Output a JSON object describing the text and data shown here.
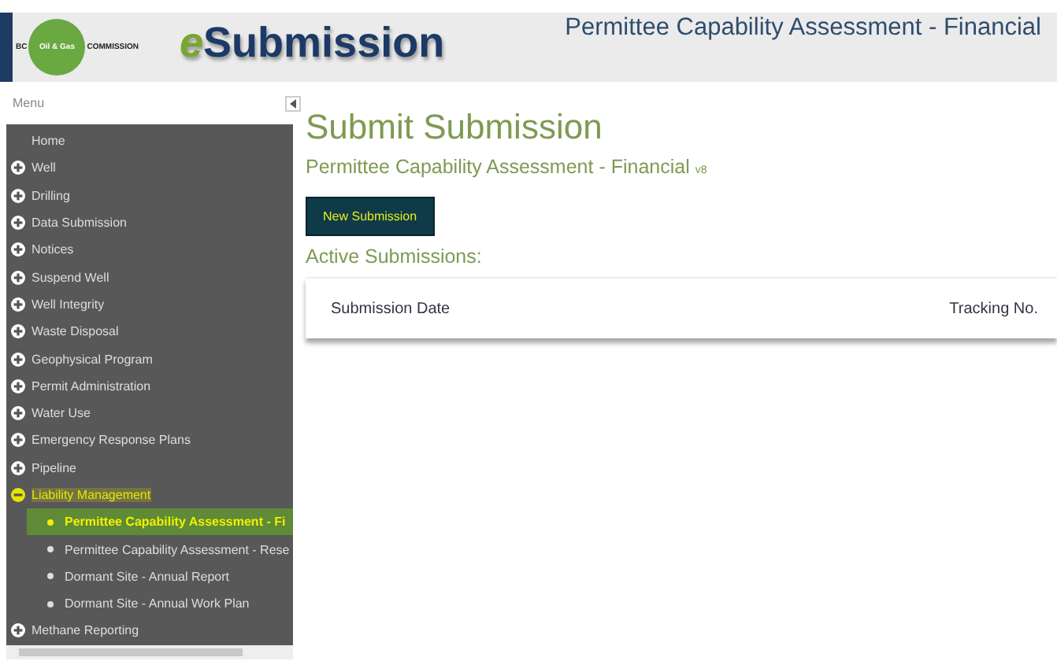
{
  "header": {
    "logo": {
      "left": "BC",
      "center": "Oil & Gas",
      "right": "COMMISSION"
    },
    "app_name": {
      "prefix": "e",
      "rest": "Submission"
    },
    "page_title": "Permittee Capability Assessment - Financial"
  },
  "sidebar": {
    "title": "Menu",
    "items": [
      {
        "label": "Home",
        "kind": "link",
        "highlighted": false
      },
      {
        "label": "Well",
        "kind": "group",
        "expanded": false,
        "highlighted": false
      },
      {
        "label": "Drilling",
        "kind": "group",
        "expanded": false,
        "highlighted": false
      },
      {
        "label": "Data Submission",
        "kind": "group",
        "expanded": false,
        "highlighted": false
      },
      {
        "label": "Notices",
        "kind": "group",
        "expanded": false,
        "highlighted": false
      },
      {
        "label": "Suspend Well",
        "kind": "group",
        "expanded": false,
        "highlighted": false
      },
      {
        "label": "Well Integrity",
        "kind": "group",
        "expanded": false,
        "highlighted": false
      },
      {
        "label": "Waste Disposal",
        "kind": "group",
        "expanded": false,
        "highlighted": false
      },
      {
        "label": "Geophysical Program",
        "kind": "group",
        "expanded": false,
        "highlighted": false
      },
      {
        "label": "Permit Administration",
        "kind": "group",
        "expanded": false,
        "highlighted": false
      },
      {
        "label": "Water Use",
        "kind": "group",
        "expanded": false,
        "highlighted": false
      },
      {
        "label": "Emergency Response Plans",
        "kind": "group",
        "expanded": false,
        "highlighted": false
      },
      {
        "label": "Pipeline",
        "kind": "group",
        "expanded": false,
        "highlighted": false
      },
      {
        "label": "Liability Management",
        "kind": "group",
        "expanded": true,
        "highlighted": true,
        "children": [
          {
            "label": "Permittee Capability Assessment - Fi",
            "selected": true
          },
          {
            "label": "Permittee Capability Assessment - Rese",
            "selected": false
          },
          {
            "label": "Dormant Site - Annual Report",
            "selected": false
          },
          {
            "label": "Dormant Site - Annual Work Plan",
            "selected": false
          }
        ]
      },
      {
        "label": "Methane Reporting",
        "kind": "group",
        "expanded": false,
        "highlighted": false
      }
    ]
  },
  "main": {
    "heading": "Submit Submission",
    "subtitle": "Permittee Capability Assessment - Financial",
    "version": "v8",
    "new_button": "New Submission",
    "section_title": "Active Submissions:",
    "table": {
      "columns": [
        "Submission Date",
        "Tracking No."
      ]
    }
  }
}
